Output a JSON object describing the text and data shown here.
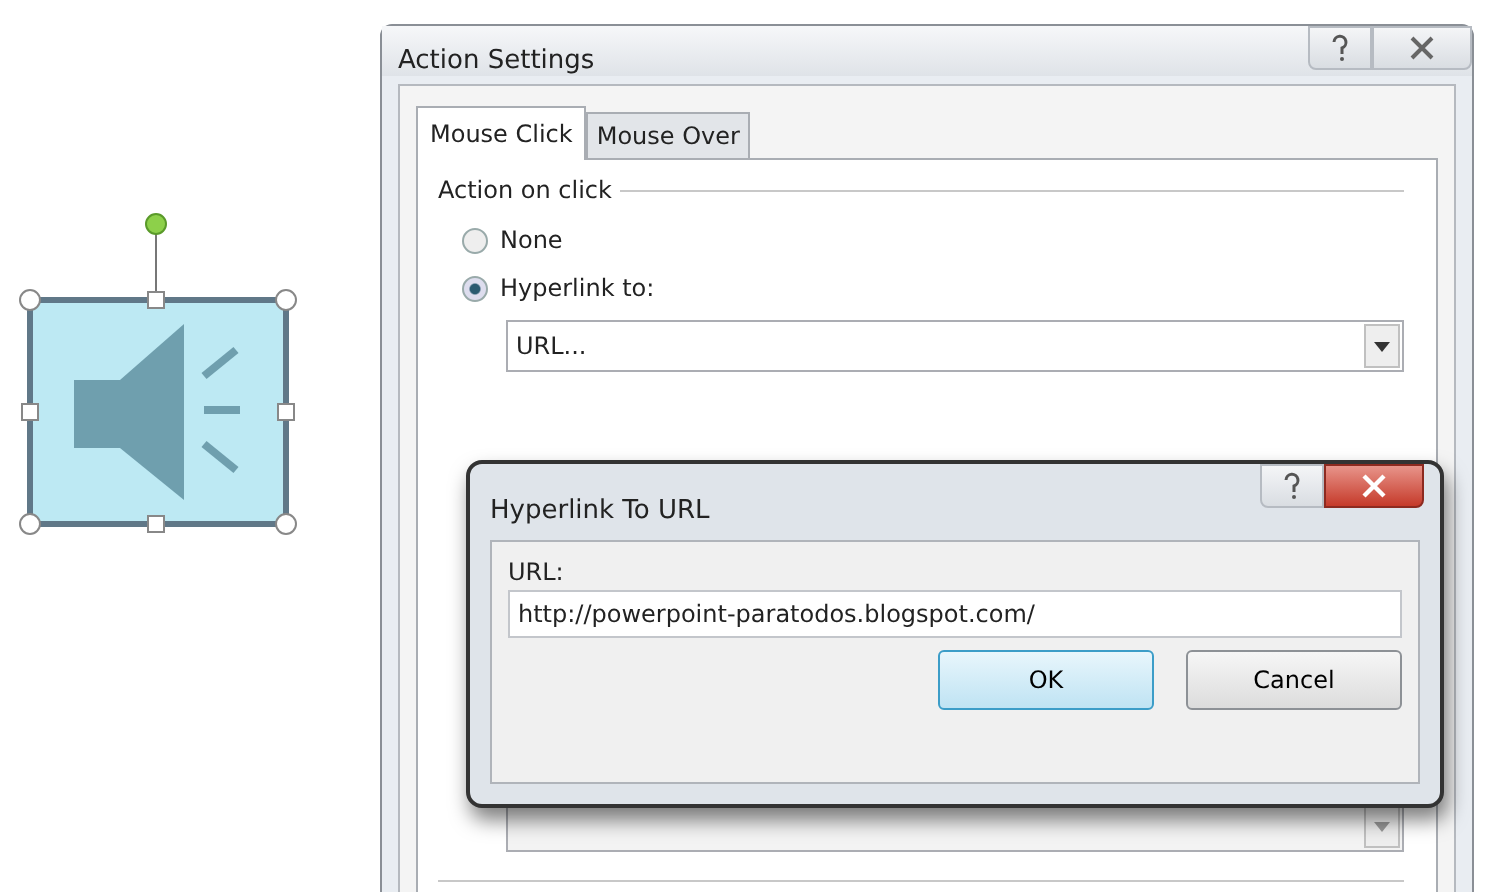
{
  "action_settings": {
    "title": "Action Settings",
    "tabs": [
      {
        "label": "Mouse Click",
        "selected": true
      },
      {
        "label": "Mouse Over",
        "selected": false
      }
    ],
    "group_label": "Action on click",
    "options": [
      {
        "label": "None",
        "selected": false
      },
      {
        "label": "Hyperlink to:",
        "selected": true
      }
    ],
    "hyperlink_value": "URL..."
  },
  "hyperlink_dialog": {
    "title": "Hyperlink To URL",
    "field_label": "URL:",
    "url": "http://powerpoint-paratodos.blogspot.com/",
    "buttons": [
      {
        "label": "OK",
        "kind": "default"
      },
      {
        "label": "Cancel",
        "kind": "normal"
      }
    ]
  }
}
